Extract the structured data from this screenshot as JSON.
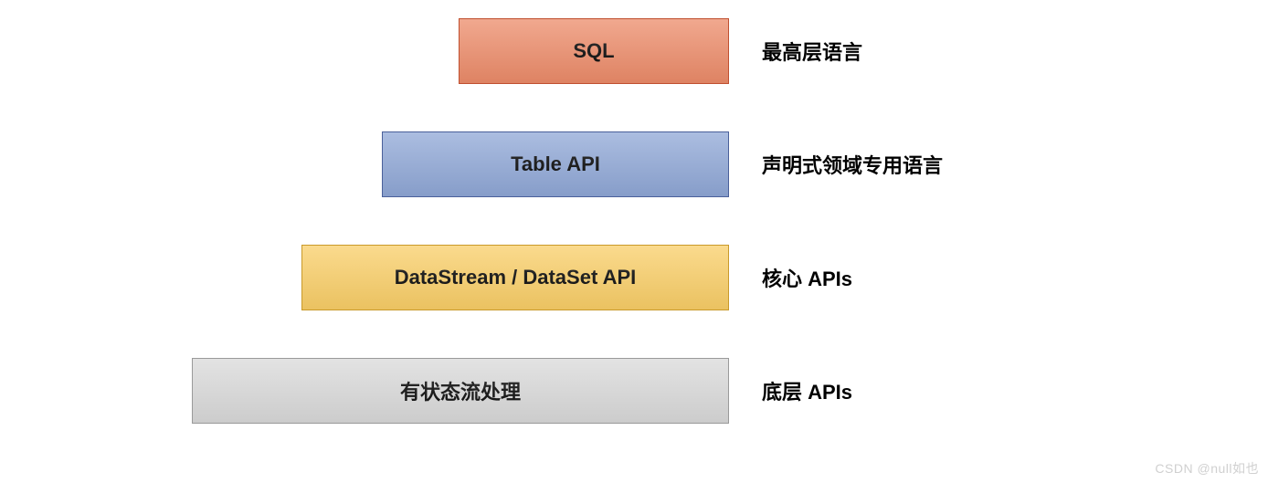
{
  "layers": [
    {
      "box_label": "SQL",
      "description": "最高层语言"
    },
    {
      "box_label": "Table API",
      "description": "声明式领域专用语言"
    },
    {
      "box_label": "DataStream / DataSet API",
      "description": "核心 APIs"
    },
    {
      "box_label": "有状态流处理",
      "description": "底层 APIs"
    }
  ],
  "watermark": "CSDN @null如也"
}
